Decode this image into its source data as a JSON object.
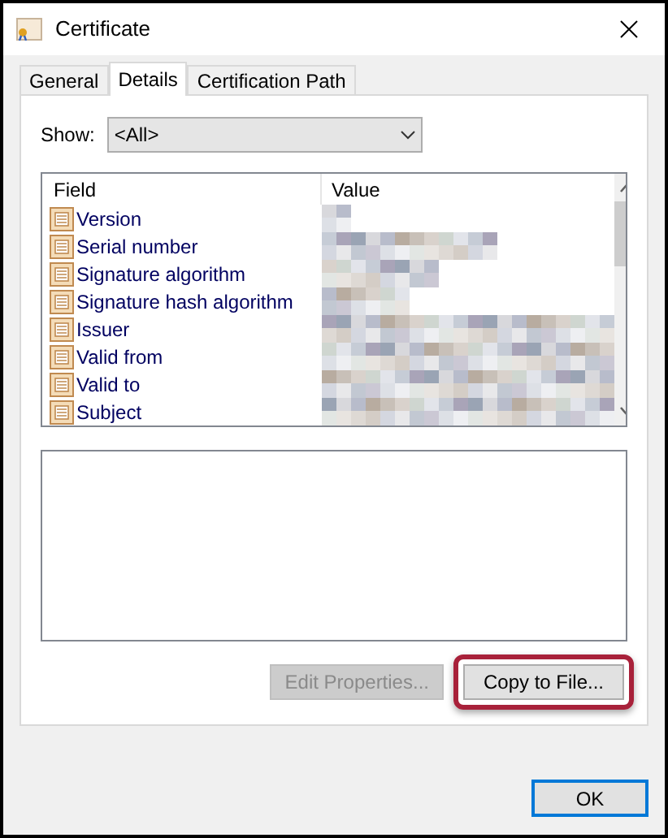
{
  "window": {
    "title": "Certificate"
  },
  "tabs": [
    {
      "label": "General",
      "selected": false
    },
    {
      "label": "Details",
      "selected": true
    },
    {
      "label": "Certification Path",
      "selected": false
    }
  ],
  "show": {
    "label": "Show:",
    "value": "<All>"
  },
  "table": {
    "columns": [
      "Field",
      "Value"
    ],
    "rows": [
      {
        "field": "Version"
      },
      {
        "field": "Serial number"
      },
      {
        "field": "Signature algorithm"
      },
      {
        "field": "Signature hash algorithm"
      },
      {
        "field": "Issuer"
      },
      {
        "field": "Valid from"
      },
      {
        "field": "Valid to"
      },
      {
        "field": "Subject"
      }
    ]
  },
  "buttons": [
    {
      "label": "Edit Properties...",
      "disabled": true,
      "highlighted": false
    },
    {
      "label": "Copy to File...",
      "disabled": false,
      "highlighted": true
    }
  ],
  "ok_button": {
    "label": "OK"
  }
}
